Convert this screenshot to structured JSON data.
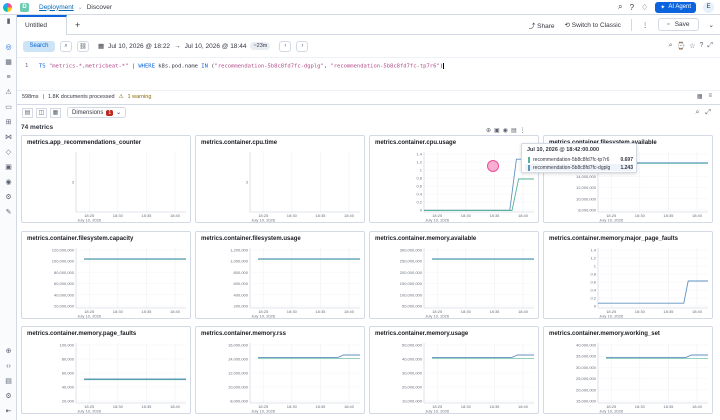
{
  "header": {
    "space_badge": "D",
    "breadcrumb_app": "Deployment",
    "breadcrumb_sep": "⌄",
    "breadcrumb_page": "Discover",
    "ai_label": "AI Agent",
    "avatar": "E"
  },
  "tabs": {
    "active": "Untitled",
    "add": "+"
  },
  "tabbar_actions": {
    "share": "Share",
    "classic": "Switch to Classic",
    "save": "Save"
  },
  "query_bar": {
    "search_label": "Search",
    "date_from": "Jul 10, 2026 @ 18:22",
    "arrow": "→",
    "date_to": "Jul 10, 2026 @ 18:44",
    "delta": "~23m"
  },
  "editor": {
    "line": "1",
    "kw1": "TS",
    "src": "\"metrics-*,metricbeat-*\"",
    "pipe": " | ",
    "kw2": "WHERE",
    "field": " k8s.pod.name ",
    "kw3": "IN",
    "open": " (",
    "v1": "\"recommendation-5b8c8fd7fc-dgplg\"",
    "comma": ", ",
    "v2": "\"recommendation-5b8c8fd7fc-tp7r6\"",
    "close": ")"
  },
  "status": {
    "duration": "598ms",
    "docs": "1.8K documents processed",
    "warning": "1 warning"
  },
  "dimensions": {
    "label": "Dimensions",
    "count": "1"
  },
  "metrics_count_label": "74 metrics",
  "x_ticks": {
    "t1": "18:25",
    "t1b": "July 10, 2026",
    "t2": "18:30",
    "t3": "18:35",
    "t4": "18:40"
  },
  "panels": [
    {
      "title": "metrics.app_recommendations_counter",
      "yticks": [
        "3"
      ],
      "series": "flat"
    },
    {
      "title": "metrics.container.cpu.time",
      "yticks": [
        "3"
      ],
      "series": "flat"
    },
    {
      "title": "metrics.container.cpu.usage",
      "yticks": [
        "1.4",
        "1.2",
        "1",
        "0.8",
        "0.6",
        "0.4",
        "0.2",
        "0"
      ],
      "series": "spike"
    },
    {
      "title": "metrics.container.filesystem.available",
      "yticks": [
        "18,000,000",
        "16,000,000",
        "14,000,000",
        "12,000,000",
        "10,000,000",
        "8,000,000"
      ],
      "series": "high"
    },
    {
      "title": "metrics.container.filesystem.capacity",
      "yticks": [
        "120,000,000",
        "100,000,000",
        "80,000,000",
        "60,000,000",
        "40,000,000",
        "20,000,000"
      ],
      "series": "high"
    },
    {
      "title": "metrics.container.filesystem.usage",
      "yticks": [
        "1,200,000",
        "1,000,000",
        "800,000",
        "600,000",
        "400,000",
        "200,000"
      ],
      "series": "high"
    },
    {
      "title": "metrics.container.memory.available",
      "yticks": [
        "300,000,000",
        "250,000,000",
        "200,000,000",
        "150,000,000",
        "100,000,000",
        "50,000,000"
      ],
      "series": "high"
    },
    {
      "title": "metrics.container.memory.major_page_faults",
      "yticks": [
        "1.4",
        "1.2",
        "1",
        "0.8",
        "0.6",
        "0.4",
        "0.2",
        "0"
      ],
      "series": "step"
    },
    {
      "title": "metrics.container.memory.page_faults",
      "yticks": [
        "100,000",
        "80,000",
        "60,000",
        "40,000",
        "20,000"
      ],
      "series": "mid"
    },
    {
      "title": "metrics.container.memory.rss",
      "yticks": [
        "16,000,000",
        "14,000,000",
        "12,000,000",
        "10,000,000",
        "8,000,000"
      ],
      "series": "high2"
    },
    {
      "title": "metrics.container.memory.usage",
      "yticks": [
        "50,000,000",
        "40,000,000",
        "30,000,000",
        "20,000,000",
        "10,000,000"
      ],
      "series": "high2"
    },
    {
      "title": "metrics.container.memory.working_set",
      "yticks": [
        "40,000,000",
        "35,000,000",
        "30,000,000",
        "25,000,000",
        "20,000,000",
        "15,000,000"
      ],
      "series": "high2"
    }
  ],
  "tooltip": {
    "time": "Jul 10, 2026 @ 18:42:00.000",
    "rows": [
      {
        "name": "recommendation-5b8c8fd7fc-tp7r6",
        "value": "0.697",
        "color": "#54b399"
      },
      {
        "name": "recommendation-5b8c8fd7fc-dgplg",
        "value": "1.243",
        "color": "#6092c0"
      }
    ]
  },
  "colors": {
    "line1": "#54b399",
    "line2": "#6092c0",
    "accent": "#0b64dd"
  }
}
